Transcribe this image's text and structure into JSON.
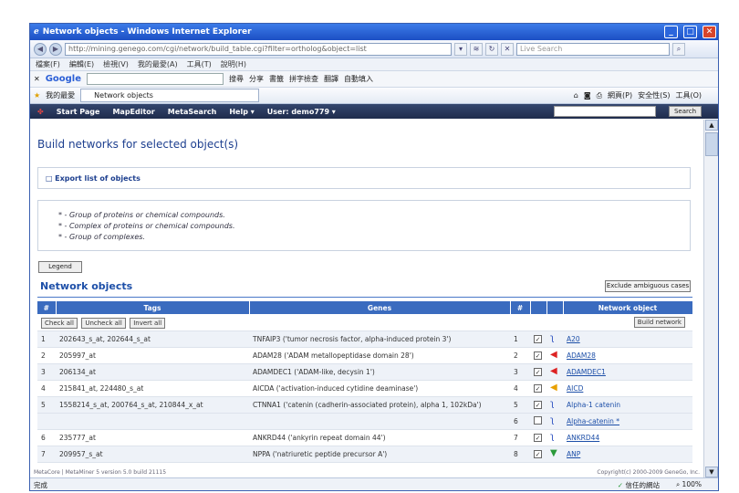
{
  "window": {
    "title": "Network objects - Windows Internet Explorer"
  },
  "address": {
    "url": "http://mining.genego.com/cgi/network/build_table.cgi?filter=ortholog&object=list",
    "search_placeholder": "Live Search"
  },
  "menu": [
    "檔案(F)",
    "編輯(E)",
    "檢視(V)",
    "我的最愛(A)",
    "工具(T)",
    "說明(H)"
  ],
  "google": {
    "label": "Google",
    "items": [
      "搜尋",
      "分享",
      "書籤",
      "拼字檢查",
      "翻譯",
      "自動填入"
    ]
  },
  "favorites": {
    "label": "我的最愛",
    "tab": "Network objects",
    "tools": [
      "網頁(P)",
      "安全性(S)",
      "工具(O)"
    ]
  },
  "site_nav": {
    "items": [
      "Start Page",
      "MapEditor",
      "MetaSearch",
      "Help ▾",
      "User: demo779 ▾"
    ],
    "search_button": "Search"
  },
  "page": {
    "title": "Build networks for selected object(s)",
    "export_label": "Export list of objects",
    "legend_lines": [
      "* - Group of proteins or chemical compounds.",
      "* - Complex of proteins or chemical compounds.",
      "* - Group of complexes."
    ],
    "legend_button": "Legend",
    "section_title": "Network objects",
    "exclude_button": "Exclude ambiguous cases",
    "table": {
      "headers": [
        "#",
        "Tags",
        "Genes",
        "#",
        "",
        "",
        "Network object"
      ],
      "buttons": [
        "Check all",
        "Uncheck all",
        "Invert all"
      ],
      "build_button": "Build network",
      "rows": [
        {
          "n": "1",
          "tags": "202643_s_at, 202644_s_at",
          "genes": "TNFAIP3 ('tumor necrosis factor, alpha-induced protein 3')",
          "m": "1",
          "object": "A20"
        },
        {
          "n": "2",
          "tags": "205997_at",
          "genes": "ADAM28 ('ADAM metallopeptidase domain 28')",
          "m": "2",
          "object": "ADAM28"
        },
        {
          "n": "3",
          "tags": "206134_at",
          "genes": "ADAMDEC1 ('ADAM-like, decysin 1')",
          "m": "3",
          "object": "ADAMDEC1"
        },
        {
          "n": "4",
          "tags": "215841_at, 224480_s_at",
          "genes": "AICDA ('activation-induced cytidine deaminase')",
          "m": "4",
          "object": "AICD"
        },
        {
          "n": "5",
          "tags": "1558214_s_at, 200764_s_at, 210844_x_at",
          "genes": "CTNNA1 ('catenin (cadherin-associated protein), alpha 1, 102kDa')",
          "m": "5",
          "object": "Alpha-1 catenin"
        },
        {
          "n": "",
          "tags": "",
          "genes": "",
          "m": "6",
          "object": "Alpha-catenin *"
        },
        {
          "n": "6",
          "tags": "235777_at",
          "genes": "ANKRD44 ('ankyrin repeat domain 44')",
          "m": "7",
          "object": "ANKRD44"
        },
        {
          "n": "7",
          "tags": "209957_s_at",
          "genes": "NPPA ('natriuretic peptide precursor A')",
          "m": "8",
          "object": "ANP"
        }
      ]
    },
    "footer_left": "MetaCore | MetaMiner 5 version 5.0 build 21115",
    "footer_right": "Copyright(c) 2000-2009 GeneGo, Inc."
  },
  "status": {
    "left": "完成",
    "zone": "信任的網站",
    "zoom": "100%"
  }
}
